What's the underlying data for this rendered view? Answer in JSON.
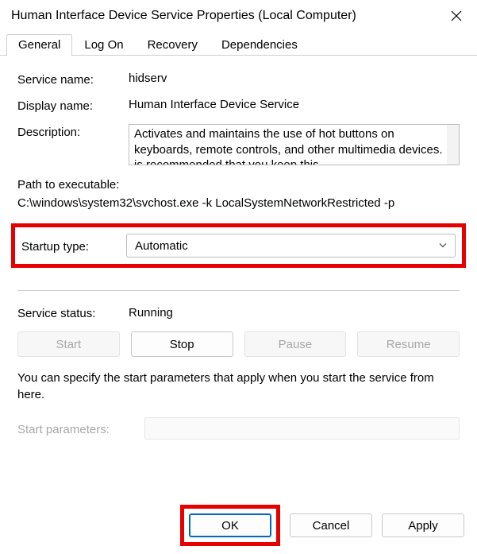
{
  "window": {
    "title": "Human Interface Device Service Properties (Local Computer)"
  },
  "tabs": {
    "general": "General",
    "logon": "Log On",
    "recovery": "Recovery",
    "dependencies": "Dependencies"
  },
  "labels": {
    "service_name": "Service name:",
    "display_name": "Display name:",
    "description": "Description:",
    "path_label": "Path to executable:",
    "startup_type": "Startup type:",
    "service_status": "Service status:",
    "start_parameters": "Start parameters:"
  },
  "values": {
    "service_name": "hidserv",
    "display_name": "Human Interface Device Service",
    "description": "Activates and maintains the use of hot buttons on keyboards, remote controls, and other multimedia devices. It is recommended that you keep this",
    "path": "C:\\windows\\system32\\svchost.exe -k LocalSystemNetworkRestricted -p",
    "startup_type": "Automatic",
    "service_status": "Running"
  },
  "buttons": {
    "start": "Start",
    "stop": "Stop",
    "pause": "Pause",
    "resume": "Resume",
    "ok": "OK",
    "cancel": "Cancel",
    "apply": "Apply"
  },
  "hint": "You can specify the start parameters that apply when you start the service from here."
}
